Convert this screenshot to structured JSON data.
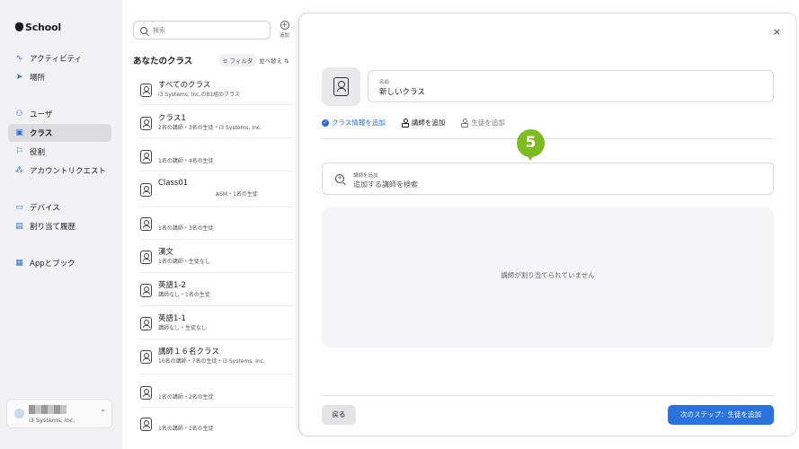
{
  "sidebar": {
    "brand": "School",
    "items": [
      {
        "label": "アクティビティ",
        "icon": "activity-icon"
      },
      {
        "label": "場所",
        "icon": "location-icon"
      },
      {
        "label": "ユーザ",
        "icon": "users-icon"
      },
      {
        "label": "クラス",
        "icon": "class-icon"
      },
      {
        "label": "役割",
        "icon": "flag-icon"
      },
      {
        "label": "アカウントリクエスト",
        "icon": "account-request-icon"
      },
      {
        "label": "デバイス",
        "icon": "laptop-icon"
      },
      {
        "label": "割り当て履歴",
        "icon": "history-icon"
      },
      {
        "label": "Appとブック",
        "icon": "apps-icon"
      }
    ],
    "account": {
      "org": "i3 Systems, Inc."
    }
  },
  "list": {
    "search_placeholder": "検索",
    "add_label": "追加",
    "title": "あなたのクラス",
    "filter_label": "フィルタ",
    "sort_label": "並べ替え",
    "classes": [
      {
        "name": "すべてのクラス",
        "sub": "i3 Systems, Inc.の81組のクラス"
      },
      {
        "name": "クラス1",
        "sub": "2名の講師・3名の生徒・i3 Systems, Inc."
      },
      {
        "name": "",
        "sub": "1名の講師・4名の生徒"
      },
      {
        "name": "Class01",
        "sub": "ASM・1名の生徒"
      },
      {
        "name": "",
        "sub": "1名の講師・3名の生徒"
      },
      {
        "name": "漢文",
        "sub": "1名の講師・生徒なし"
      },
      {
        "name": "英語1-2",
        "sub": "講師なし・1名の生徒"
      },
      {
        "name": "英語1-1",
        "sub": "講師なし・生徒なし"
      },
      {
        "name": "講師１６名クラス",
        "sub": "16名の講師・7名の生徒・i3 Systems, Inc."
      },
      {
        "name": "",
        "sub": "1名の講師・2名の生徒"
      },
      {
        "name": "",
        "sub": "1名の講師・1名の生徒"
      }
    ]
  },
  "panel": {
    "close_label": "×",
    "name_label": "名前",
    "name_value": "新しいクラス",
    "steps": [
      {
        "label": "クラス情報を追加",
        "state": "done"
      },
      {
        "label": "講師を追加",
        "state": "current"
      },
      {
        "label": "生徒を追加",
        "state": "pending"
      }
    ],
    "callout_number": "5",
    "teacher_search_label": "講師を追加",
    "teacher_search_placeholder": "追加する講師を検索",
    "empty_message": "講師が割り当てられていません",
    "back_label": "戻る",
    "next_label": "次のステップ：生徒を追加"
  },
  "colors": {
    "accent": "#2a73de",
    "callout": "#7dbb1f"
  }
}
